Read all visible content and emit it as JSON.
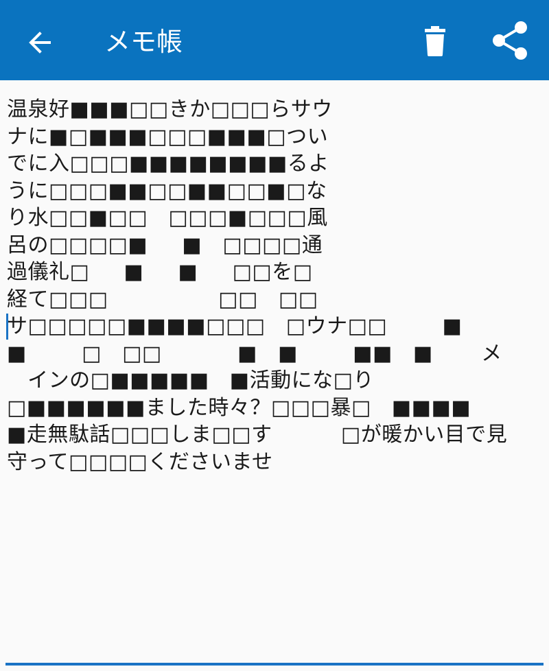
{
  "app": {
    "title": "メモ帳",
    "bar_color": "#0a73bf",
    "icons": {
      "back": "arrow-left-icon",
      "delete": "trash-icon",
      "share": "share-icon"
    }
  },
  "memo": {
    "lines": [
      "温泉好■■■□□きか□□□らサウ",
      "ナに■□■■■□□□■■■□つい",
      "でに入□□□■■■■■■■■るよ",
      "うに□□□■■□□■■□□■□な",
      "り水□□■□□   □□□■□□□風",
      "呂の□□□□■     ■   □□□□通",
      "過儀礼□     ■     ■     □□を□",
      "経て□□□                □□   □□",
      "サ□□□□□■■■■□□□   □ウナ□□        ■",
      "■        □   □□           ■   ■        ■■   ■       メ",
      "   インの□■■■■■   ■活動にな□り",
      "□■■■■■■ました時々？□□□暴□   ■■■■",
      "■走無駄話□□□しま□□す          □が暖かい目で見",
      "守って□□□□くださいませ"
    ]
  }
}
